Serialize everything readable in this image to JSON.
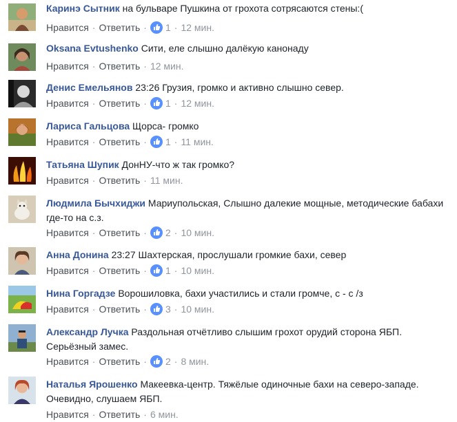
{
  "labels": {
    "like": "Нравится",
    "reply": "Ответить",
    "sep": "·"
  },
  "colors": {
    "author": "#385898",
    "action": "#4b4f56",
    "meta": "#90949c",
    "like_badge": "#5890ff"
  },
  "comments": [
    {
      "author": "Каринэ Сытник",
      "text": "на бульваре Пушкина от грохота сотрясаются стены:(",
      "likes": "1",
      "time": "12 мин."
    },
    {
      "author": "Oksana Evtushenko",
      "text": "Сити, еле слышно далёкую канонаду",
      "likes": "",
      "time": "12 мин."
    },
    {
      "author": "Денис Емельянов",
      "text": "23:26 Грузия, громко и активно слышно север.",
      "likes": "1",
      "time": "12 мин."
    },
    {
      "author": "Лариса Гальцова",
      "text": "Щорса- громко",
      "likes": "1",
      "time": "11 мин."
    },
    {
      "author": "Татьяна Шупик",
      "text": "ДонНУ-что ж так громко?",
      "likes": "",
      "time": "11 мин."
    },
    {
      "author": "Людмила Бычхиджи",
      "text": "Мариупольская, Слышно далекие мощные, методические бабахи где-то на с.з.",
      "likes": "2",
      "time": "10 мин."
    },
    {
      "author": "Анна Донина",
      "text": "23:27 Шахтерская, прослушали громкие бахи, север",
      "likes": "1",
      "time": "10 мин."
    },
    {
      "author": "Нина Горгадзе",
      "text": "Ворошиловка, бахи участились и стали громче, с - с /з",
      "likes": "3",
      "time": "10 мин."
    },
    {
      "author": "Александр Лучка",
      "text": "Раздольная отчётливо слышим грохот орудий сторона ЯБП. Серьёзный замес.",
      "likes": "2",
      "time": "8 мин."
    },
    {
      "author": "Наталья Ярошенко",
      "text": "Макеевка-центр. Тяжёлые одиночные бахи на северо-западе. Очевидно, слушаем ЯБП.",
      "likes": "",
      "time": "6 мин."
    }
  ]
}
